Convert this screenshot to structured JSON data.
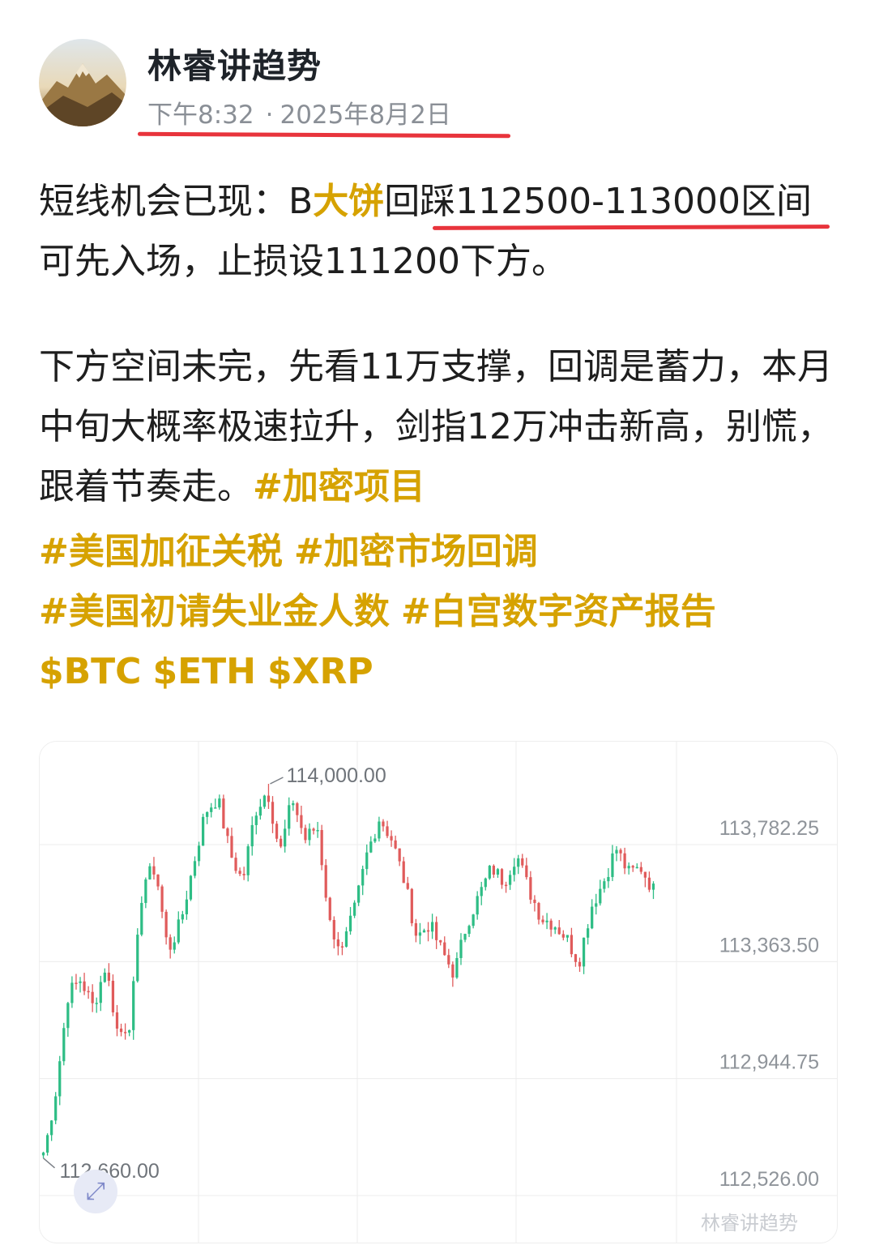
{
  "post": {
    "author": "林睿讲趋势",
    "time": "下午8:32",
    "date": "2025年8月2日"
  },
  "body": {
    "p1_a": "短线机会已现：B",
    "p1_gold": "大饼",
    "p1_b": "回踩112500-113000区间可先入场，止损设111200下方。",
    "p2_a": "下方空间未完，先看11万支撑，回调是蓄力，本月中旬大概率极速拉升，剑指12万冲击新高，别慌，跟着节奏走。",
    "p2_tag": "#加密项目"
  },
  "tags": [
    "#美国加征关税",
    "#加密市场回调",
    "#美国初请失业金人数",
    "#白宫数字资产报告",
    "$BTC",
    "$ETH",
    "$XRP"
  ],
  "colors": {
    "up": "#2ebd85",
    "down": "#e05b5b",
    "accent": "#d6a200",
    "highlight_line": "#e8343c"
  },
  "icons": {
    "expand": "expand-arrows-icon"
  },
  "watermark": "林睿讲趋势",
  "chart_data": {
    "type": "candlestick",
    "high_label": "114,000.00",
    "low_label": "112,660.00",
    "y_tick_labels": [
      "113,782.25",
      "113,363.50",
      "112,944.75",
      "112,526.00"
    ],
    "y_ticks": [
      113782.25,
      113363.5,
      112944.75,
      112526.0
    ],
    "ylim": [
      112526,
      114000
    ],
    "high": 114000,
    "low": 112660,
    "grid": true,
    "path": [
      112660,
      112900,
      113250,
      113300,
      113200,
      113350,
      113100,
      113150,
      113650,
      113700,
      113400,
      113500,
      113700,
      113900,
      113950,
      113750,
      113650,
      113900,
      113980,
      113750,
      113950,
      113800,
      113850,
      113500,
      113400,
      113550,
      113750,
      113880,
      113800,
      113650,
      113450,
      113500,
      113400,
      113320,
      113500,
      113600,
      113700,
      113650,
      113750,
      113620,
      113520,
      113500,
      113450,
      113360,
      113560,
      113650,
      113770,
      113680,
      113700,
      113620
    ]
  }
}
